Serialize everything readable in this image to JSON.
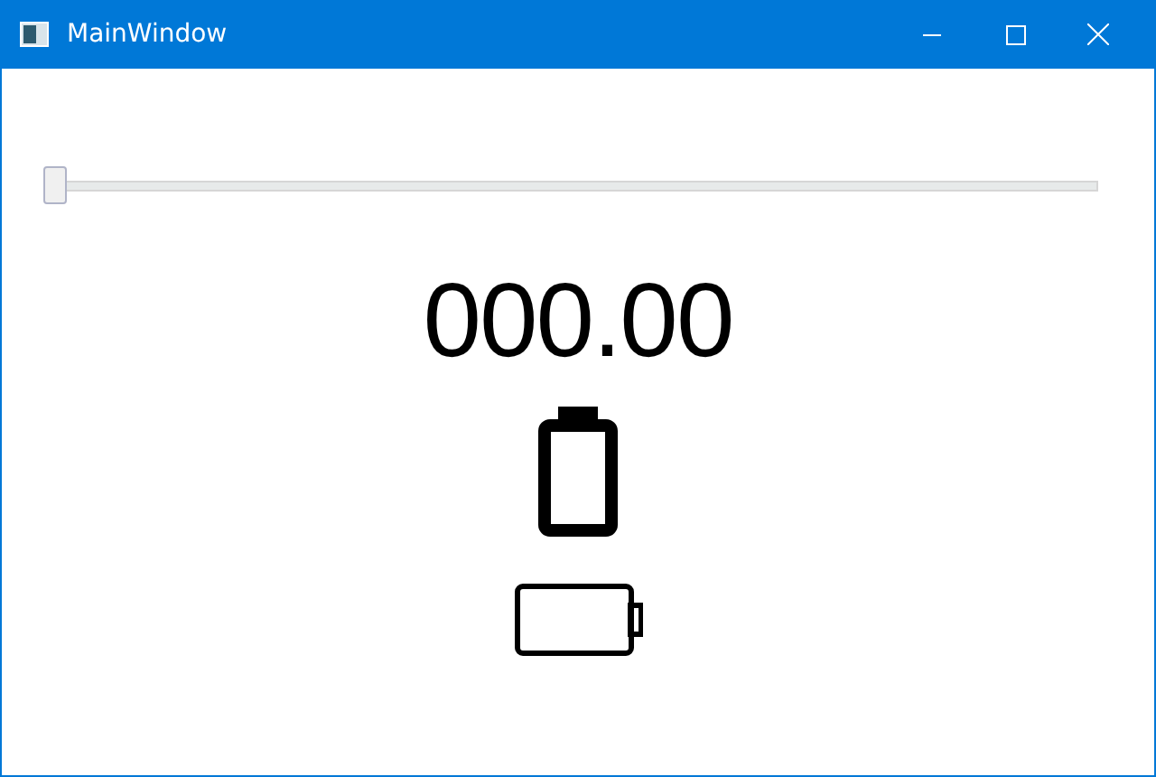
{
  "window": {
    "title": "MainWindow"
  },
  "slider": {
    "level": 0
  },
  "reading": "000.00"
}
